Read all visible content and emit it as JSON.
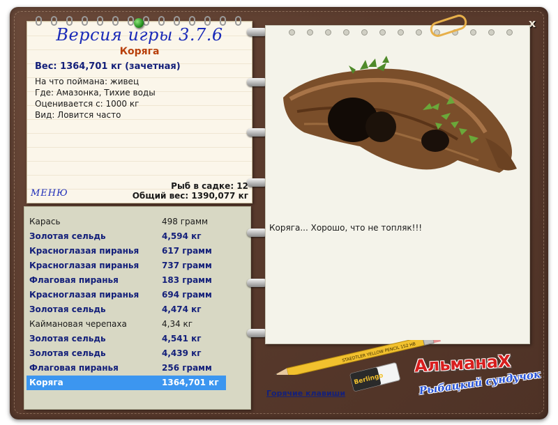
{
  "header": {
    "close_label": "x"
  },
  "info": {
    "version_title": "Версия игры 3.7.6",
    "fish_name": "Коряга",
    "weight_line": "Вес: 1364,701 кг (зачетная)",
    "details": [
      "На что поймана: живец",
      "Где: Амазонка, Тихие воды",
      "Оценивается с: 1000 кг",
      "Вид: Ловится часто"
    ],
    "menu_label": "МЕНЮ",
    "fish_in_keepnet": "Рыб в садке: 12",
    "total_weight": "Общий вес: 1390,077 кг"
  },
  "catch_list": [
    {
      "name": "Карась",
      "weight": "498 грамм",
      "style": "plain"
    },
    {
      "name": "Золотая сельдь",
      "weight": "4,594 кг",
      "style": "bold"
    },
    {
      "name": "Красноглазая пиранья",
      "weight": "617 грамм",
      "style": "bold"
    },
    {
      "name": "Красноглазая пиранья",
      "weight": "737 грамм",
      "style": "bold"
    },
    {
      "name": "Флаговая пиранья",
      "weight": "183 грамм",
      "style": "bold"
    },
    {
      "name": "Красноглазая пиранья",
      "weight": "694 грамм",
      "style": "bold"
    },
    {
      "name": "Золотая сельдь",
      "weight": "4,474 кг",
      "style": "bold"
    },
    {
      "name": "Каймановая черепаха",
      "weight": "4,34 кг",
      "style": "plain"
    },
    {
      "name": "Золотая сельдь",
      "weight": "4,541 кг",
      "style": "bold"
    },
    {
      "name": "Золотая сельдь",
      "weight": "4,439 кг",
      "style": "bold"
    },
    {
      "name": "Флаговая пиранья",
      "weight": "256 грамм",
      "style": "bold"
    },
    {
      "name": "Коряга",
      "weight": "1364,701 кг",
      "style": "selected"
    }
  ],
  "right": {
    "message": "Коряга... Хорошо, что не топляк!!!",
    "hotkeys_label": "Горячие клавиши",
    "logo_main": "АльманаХ",
    "logo_sub": "Рыбацкий сундучок",
    "pencil_text": "STAEDTLER YELLOW PENCIL 152 HB",
    "eraser_text": "Berlingo"
  },
  "colors": {
    "selected_row": "#3c96f0",
    "list_text_bold": "#14207a",
    "title_blue": "#1a2ab8",
    "fish_name": "#b8400c",
    "logo_red": "#d81e1e",
    "logo_blue": "#2a55d8"
  }
}
